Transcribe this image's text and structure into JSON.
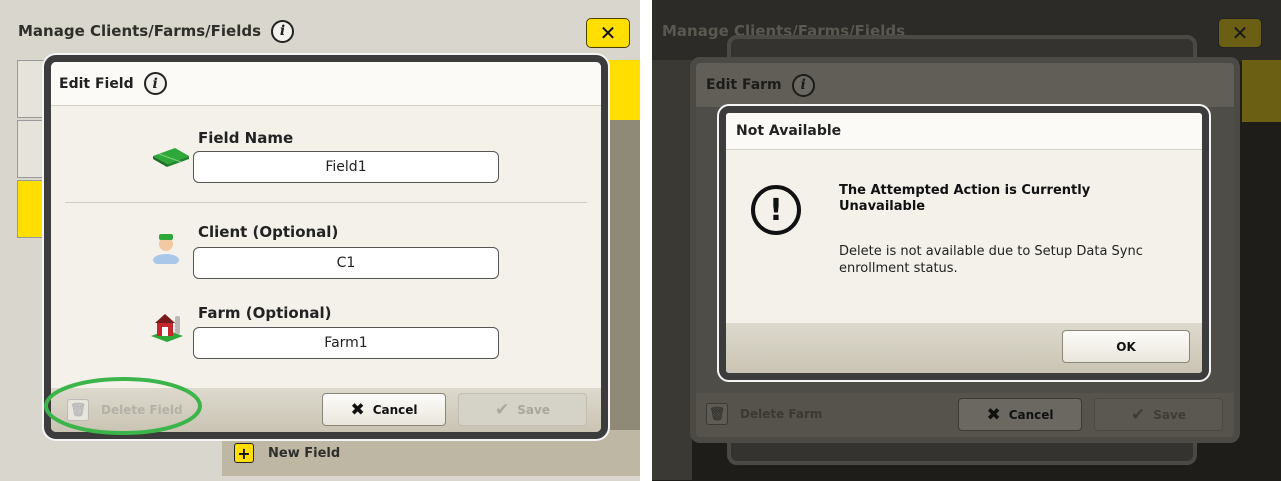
{
  "left": {
    "window_title": "Manage Clients/Farms/Fields",
    "new_field_label": "New Field",
    "dialog": {
      "title": "Edit Field",
      "field_name_label": "Field Name",
      "field_name_value": "Field1",
      "client_label": "Client (Optional)",
      "client_value": "C1",
      "farm_label": "Farm (Optional)",
      "farm_value": "Farm1",
      "delete_label": "Delete Field",
      "cancel_label": "Cancel",
      "save_label": "Save"
    },
    "annotation_color": "#3bb54a"
  },
  "right": {
    "window_title": "Manage Clients/Farms/Fields",
    "edit_dialog": {
      "title": "Edit Farm",
      "delete_label": "Delete Farm",
      "cancel_label": "Cancel",
      "save_label": "Save"
    },
    "alert": {
      "title": "Not Available",
      "heading": "The Attempted Action is Currently Unavailable",
      "message": "Delete is not available due to Setup Data Sync enrollment status.",
      "ok_label": "OK"
    }
  },
  "icons": {
    "info": "i",
    "close": "✕",
    "plus": "+",
    "trash": "🗑",
    "cancel": "✖",
    "save": "✔",
    "warning": "!"
  },
  "colors": {
    "accent_yellow": "#ffde00",
    "dialog_bg": "#f3f1ea"
  }
}
